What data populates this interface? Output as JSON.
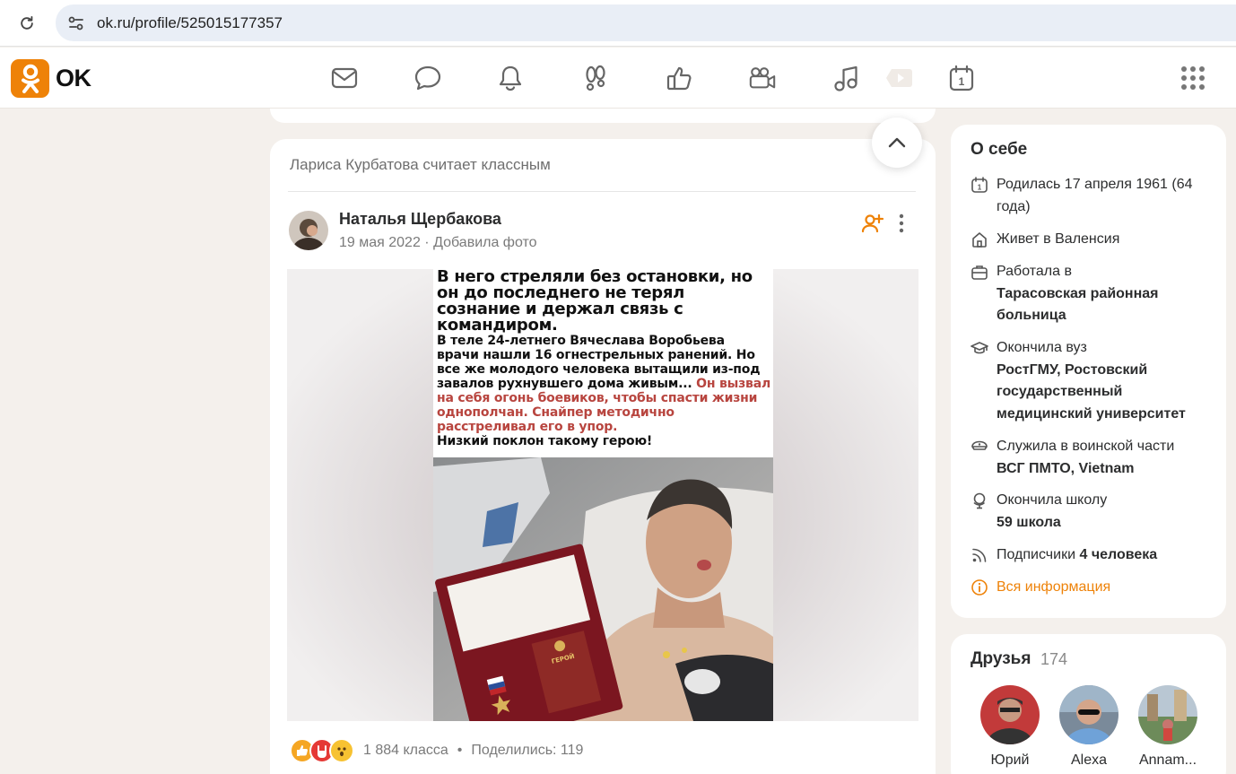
{
  "browser": {
    "url": "ok.ru/profile/525015177357"
  },
  "header": {
    "logo_text": "OK",
    "nav_icons": [
      "mail-icon",
      "chat-icon",
      "bell-icon",
      "guests-icon",
      "like-icon",
      "video-camera-icon",
      "music-icon",
      "video-icon",
      "calendar-icon"
    ],
    "calendar_day": "1",
    "accent_color": "#ee8208"
  },
  "post": {
    "context": "Лариса Курбатова считает классным",
    "author": "Наталья Щербакова",
    "date": "19 мая 2022",
    "action": "Добавила фото",
    "image_text": {
      "title": "В него стреляли без остановки, но он до последнего не терял сознание и держал связь с командиром.",
      "body": "В теле 24-летнего Вячеслава Воробьева врачи нашли 16 огнестрельных ранений. Но все же молодого человека вытащили из-под завалов рухнувшего дома живым...",
      "body_red": "Он вызвал на себя огонь боевиков, чтобы спасти жизни однополчан. Снайпер методично расстреливал его в упор.",
      "closing": "Низкий поклон такому герою!",
      "box_label": "ГЕРОЙ РОССИЙСКОЙ ФЕДЕРАЦИИ"
    },
    "reactions_count": "1 884 класса",
    "shares": "Поделились: 119"
  },
  "about": {
    "title": "О себе",
    "born": "Родилась 17 апреля 1961 (64 года)",
    "lives": "Живет в Валенсия",
    "work_label": "Работала в",
    "work_place": "Тарасовская районная больница",
    "uni_label": "Окончила вуз",
    "uni_name": "РостГМУ, Ростовский государственный медицинский университет",
    "military_label": "Служила в воинской части",
    "military_unit": "ВСГ ПМТО, Vietnam",
    "school_label": "Окончила школу",
    "school_name": "59 школа",
    "followers_label": "Подписчики",
    "followers_value": "4 человека",
    "all_info": "Вся информация"
  },
  "friends": {
    "title": "Друзья",
    "count": "174",
    "items": [
      {
        "name": "Юрий"
      },
      {
        "name": "Alexa"
      },
      {
        "name": "Annam..."
      }
    ]
  }
}
